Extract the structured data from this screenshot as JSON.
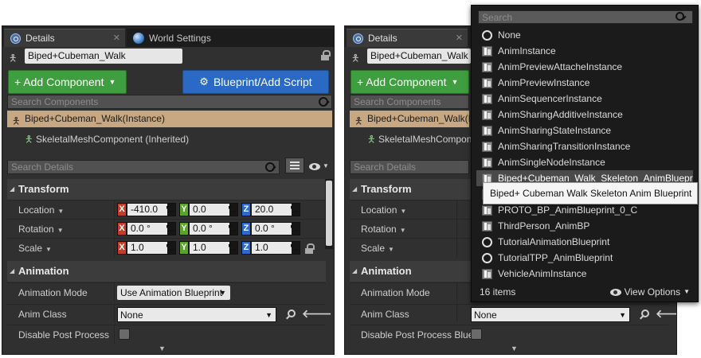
{
  "left": {
    "tabs": [
      {
        "label": "Details",
        "close": "✕"
      },
      {
        "label": "World Settings",
        "close": "✕"
      }
    ],
    "actor_name": "Biped+Cubeman_Walk",
    "add_component": "+ Add Component",
    "blueprint_script": "Blueprint/Add Script",
    "search_components_placeholder": "Search Components",
    "selected_component": "Biped+Cubeman_Walk(Instance)",
    "child_component": "SkeletalMeshComponent (Inherited)",
    "search_details_placeholder": "Search Details",
    "transform": {
      "header": "Transform",
      "location_label": "Location",
      "rotation_label": "Rotation",
      "scale_label": "Scale",
      "location": [
        "-410.0",
        "0.0",
        "20.0"
      ],
      "rotation": [
        "0.0 °",
        "0.0 °",
        "0.0 °"
      ],
      "scale": [
        "1.0",
        "1.0",
        "1.0"
      ],
      "axis": [
        "X",
        "Y",
        "Z"
      ]
    },
    "animation": {
      "header": "Animation",
      "mode_label": "Animation Mode",
      "mode_value": "Use Animation Blueprint",
      "class_label": "Anim Class",
      "class_value": "None",
      "disable_pp_label": "Disable Post Process"
    }
  },
  "right": {
    "tabs": [
      {
        "label": "Details",
        "close": "✕"
      }
    ],
    "actor_name": "Biped+Cubeman_Walk",
    "add_component": "+ Add Component",
    "search_components_placeholder": "Search Components",
    "selected_component": "Biped+Cubeman_Walk(I",
    "child_component": "SkeletalMeshCompon",
    "search_details_placeholder": "Search Details",
    "transform": {
      "header": "Transform",
      "location_label": "Location",
      "rotation_label": "Rotation",
      "scale_label": "Scale"
    },
    "animation": {
      "header": "Animation",
      "mode_label": "Animation Mode",
      "class_label": "Anim Class",
      "class_value": "None",
      "disable_pp_label": "Disable Post Process Blue"
    }
  },
  "popup": {
    "search_placeholder": "Search",
    "items": [
      {
        "label": "None",
        "icon": "circle"
      },
      {
        "label": "AnimInstance",
        "icon": "anim"
      },
      {
        "label": "AnimPreviewAttacheInstance",
        "icon": "anim"
      },
      {
        "label": "AnimPreviewInstance",
        "icon": "anim"
      },
      {
        "label": "AnimSequencerInstance",
        "icon": "anim"
      },
      {
        "label": "AnimSharingAdditiveInstance",
        "icon": "anim"
      },
      {
        "label": "AnimSharingStateInstance",
        "icon": "anim"
      },
      {
        "label": "AnimSharingTransitionInstance",
        "icon": "anim"
      },
      {
        "label": "AnimSingleNodeInstance",
        "icon": "anim"
      },
      {
        "label": "Biped+Cubeman_Walk_Skeleton_AnimBlueprint",
        "icon": "anim"
      },
      {
        "label": "",
        "icon": "anim"
      },
      {
        "label": "PROTO_BP_AnimBlueprint_0_C",
        "icon": "anim"
      },
      {
        "label": "ThirdPerson_AnimBP",
        "icon": "anim"
      },
      {
        "label": "TutorialAnimationBlueprint",
        "icon": "circle"
      },
      {
        "label": "TutorialTPP_AnimBlueprint",
        "icon": "circle"
      },
      {
        "label": "VehicleAnimInstance",
        "icon": "anim"
      }
    ],
    "count": "16 items",
    "view_options": "View Options"
  },
  "tooltip": "Biped+ Cubeman Walk Skeleton Anim Blueprint"
}
